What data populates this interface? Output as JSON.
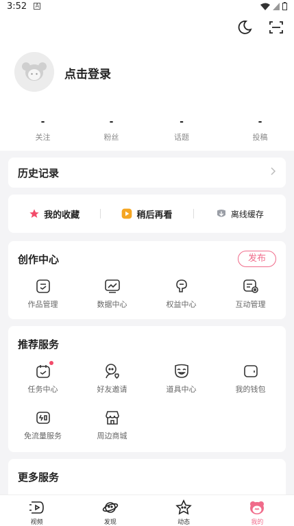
{
  "status": {
    "time": "3:52"
  },
  "profile": {
    "login_text": "点击登录"
  },
  "stats": [
    {
      "value": "-",
      "label": "关注"
    },
    {
      "value": "-",
      "label": "粉丝"
    },
    {
      "value": "-",
      "label": "话题"
    },
    {
      "value": "-",
      "label": "投稿"
    }
  ],
  "history": {
    "title": "历史记录"
  },
  "quick": [
    {
      "label": "我的收藏",
      "icon": "star-icon"
    },
    {
      "label": "稍后再看",
      "icon": "watch-later-icon"
    },
    {
      "label": "离线缓存",
      "icon": "download-icon"
    }
  ],
  "creation": {
    "title": "创作中心",
    "publish": "发布",
    "items": [
      {
        "label": "作品管理",
        "icon": "works-icon"
      },
      {
        "label": "数据中心",
        "icon": "data-chart-icon"
      },
      {
        "label": "权益中心",
        "icon": "benefit-icon"
      },
      {
        "label": "互动管理",
        "icon": "interaction-icon"
      }
    ]
  },
  "recommend": {
    "title": "推荐服务",
    "items": [
      {
        "label": "任务中心",
        "icon": "task-calendar-icon",
        "dot": true
      },
      {
        "label": "好友邀请",
        "icon": "friend-invite-icon"
      },
      {
        "label": "道具中心",
        "icon": "prop-mask-icon"
      },
      {
        "label": "我的钱包",
        "icon": "wallet-icon"
      },
      {
        "label": "免流量服务",
        "icon": "data-free-icon"
      },
      {
        "label": "周边商城",
        "icon": "store-icon"
      }
    ]
  },
  "more": {
    "title": "更多服务"
  },
  "tabs": [
    {
      "label": "视频",
      "icon": "video-tab-icon",
      "active": false
    },
    {
      "label": "发现",
      "icon": "planet-tab-icon",
      "active": false
    },
    {
      "label": "动态",
      "icon": "star-face-tab-icon",
      "active": false
    },
    {
      "label": "我的",
      "icon": "mine-tab-icon",
      "active": true
    }
  ],
  "colors": {
    "accent": "#f06b8a",
    "background": "#f4f4f6"
  }
}
